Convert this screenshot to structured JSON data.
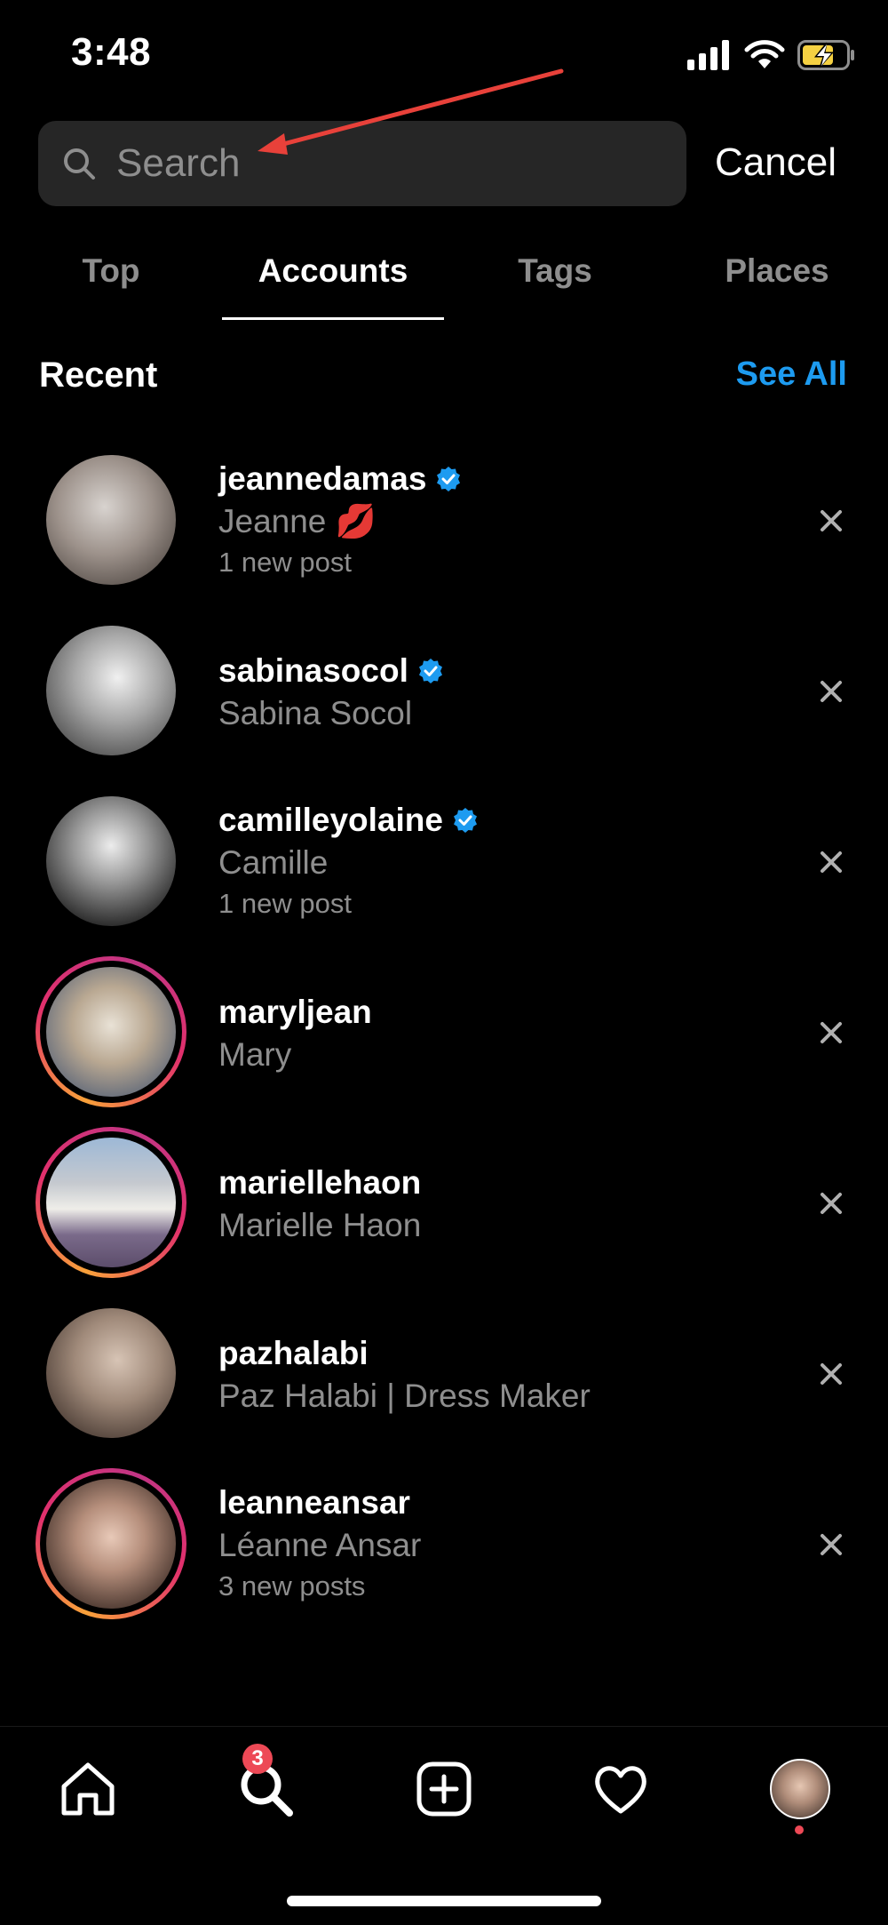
{
  "status_bar": {
    "time": "3:48"
  },
  "search": {
    "placeholder": "Search",
    "cancel_label": "Cancel"
  },
  "tabs": [
    {
      "label": "Top",
      "active": false
    },
    {
      "label": "Accounts",
      "active": true
    },
    {
      "label": "Tags",
      "active": false
    },
    {
      "label": "Places",
      "active": false
    }
  ],
  "recent": {
    "title": "Recent",
    "see_all_label": "See All"
  },
  "accounts": [
    {
      "username": "jeannedamas",
      "full_name": "Jeanne 💋",
      "meta": "1 new post",
      "verified": true
    },
    {
      "username": "sabinasocol",
      "full_name": "Sabina Socol",
      "meta": "",
      "verified": true
    },
    {
      "username": "camilleyolaine",
      "full_name": "Camille",
      "meta": "1 new post",
      "verified": true
    },
    {
      "username": "maryljean",
      "full_name": "Mary",
      "meta": "",
      "verified": false
    },
    {
      "username": "mariellehaon",
      "full_name": "Marielle Haon",
      "meta": "",
      "verified": false
    },
    {
      "username": "pazhalabi",
      "full_name": "Paz Halabi | Dress Maker",
      "meta": "",
      "verified": false
    },
    {
      "username": "leanneansar",
      "full_name": "Léanne Ansar",
      "meta": "3 new posts",
      "verified": false
    }
  ],
  "bottom_nav": {
    "items": [
      "home-icon",
      "search-icon",
      "create-post-icon",
      "activity-heart-icon",
      "profile-avatar"
    ],
    "search_badge": "3"
  },
  "colors": {
    "accent": "#1d9bf0",
    "badge": "#ed4956",
    "annotation_arrow": "#e8413a"
  }
}
